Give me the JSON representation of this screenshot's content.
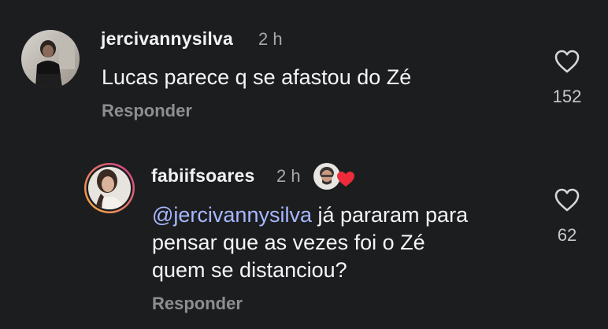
{
  "comments": [
    {
      "username": "jercivannysilva",
      "time": "2 h",
      "text": "Lucas parece q se afastou do Zé",
      "reply_label": "Responder",
      "likes": "152",
      "icons": {
        "like": "heart-outline-icon",
        "avatar": "user-avatar-photo"
      }
    }
  ],
  "reply": {
    "username": "fabiifsoares",
    "time": "2 h",
    "mention": "@jercivannysilva",
    "line1_rest": " já pararam para",
    "line2": "pensar que as vezes foi o Zé",
    "line3": "quem se distanciou?",
    "reply_label": "Responder",
    "likes": "62",
    "icons": {
      "like": "heart-outline-icon",
      "creator_reaction": "creator-liked-badge-icon",
      "avatar": "user-avatar-photo"
    }
  },
  "colors": {
    "background": "#1c1d1f",
    "mention": "#a7b8ff",
    "reaction_heart": "#ed2b3a",
    "story_ring_start": "#f5b042",
    "story_ring_end": "#d23a8c"
  }
}
